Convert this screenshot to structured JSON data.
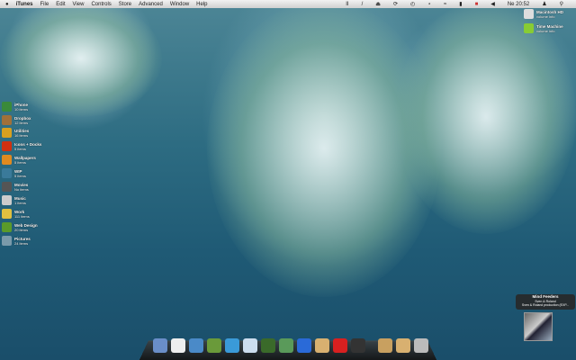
{
  "menubar": {
    "apple": "",
    "app": "iTunes",
    "items": [
      "File",
      "Edit",
      "View",
      "Controls",
      "Store",
      "Advanced",
      "Window",
      "Help"
    ],
    "clock": "Ne 20:52"
  },
  "desktop_drives": [
    {
      "name": "Macintosh HD",
      "detail": "volume info"
    },
    {
      "name": "Time Machine",
      "detail": "volume info"
    }
  ],
  "stacks": [
    {
      "name": "iPhone",
      "count": "10 items",
      "color": "#3a8a3a"
    },
    {
      "name": "Dropbox",
      "count": "12 items",
      "color": "#a0703a"
    },
    {
      "name": "Utilities",
      "count": "16 items",
      "color": "#d8a020"
    },
    {
      "name": "Icons + Docks",
      "count": "5 items",
      "color": "#d03010"
    },
    {
      "name": "Wallpapers",
      "count": "5 items",
      "color": "#e08a20"
    },
    {
      "name": "WIP",
      "count": "5 items",
      "color": "#3a7a9a"
    },
    {
      "name": "Movies",
      "count": "No items",
      "color": "#555"
    },
    {
      "name": "Music",
      "count": "1 items",
      "color": "#ccc"
    },
    {
      "name": "Work",
      "count": "111 items",
      "color": "#e0c040"
    },
    {
      "name": "Web Design",
      "count": "20 items",
      "color": "#5a9a2a"
    },
    {
      "name": "Pictures",
      "count": "24 items",
      "color": "#7a9aaa"
    }
  ],
  "now_playing": {
    "title": "Mind Feeders",
    "artist": "Sven & Roland",
    "album": "Sven & Roland production (EXP..."
  },
  "dock": [
    "Finder",
    "Mail",
    "Safari",
    "Adium",
    "Twitter",
    "iTunes",
    "Bonsai",
    "iPhoto",
    "Pencil",
    "Coffee",
    "Calendar",
    "Disk",
    "Documents",
    "Applications",
    "Trash"
  ]
}
